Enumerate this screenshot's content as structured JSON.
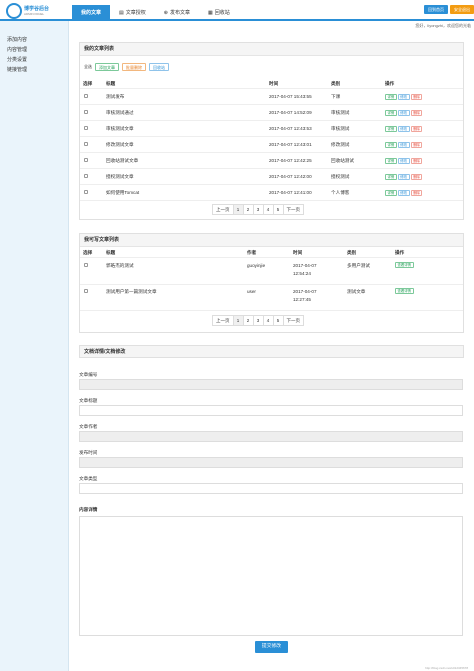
{
  "header": {
    "logo_text": "博学谷后台",
    "logo_sub": "ADMIN PANEL",
    "tabs": [
      {
        "label": "我的文章",
        "icon": "doc-icon",
        "active": true
      },
      {
        "label": "文章授权",
        "icon": "file-icon",
        "active": false
      },
      {
        "label": "发布文章",
        "icon": "plus-icon",
        "active": false
      },
      {
        "label": "回收站",
        "icon": "trash-icon",
        "active": false
      }
    ],
    "btn_home": "回到首页",
    "btn_logout": "安全退出",
    "greeting": "您好，liyongzhi，欢迎您的光临"
  },
  "sidebar": {
    "items": [
      "添加内容",
      "内容管理",
      "分类设置",
      "链接管理"
    ]
  },
  "my_articles": {
    "title": "我的文章列表",
    "select_all": "全选",
    "btn_add": "添加文章",
    "btn_delete": "批量删除",
    "btn_recycle": "回收站",
    "headers": [
      "选择",
      "标题",
      "时间",
      "类别",
      "操作"
    ],
    "rows": [
      {
        "title": "测试发布",
        "time": "2017-04-07 15:43:55",
        "category": "下课"
      },
      {
        "title": "审核测试通过",
        "time": "2017-04-07 14:52:09",
        "category": "审核测试"
      },
      {
        "title": "审核测试文章",
        "time": "2017-04-07 12:43:53",
        "category": "审核测试"
      },
      {
        "title": "修改测试文章",
        "time": "2017-04-07 12:43:01",
        "category": "修改测试"
      },
      {
        "title": "回收站测试文章",
        "time": "2017-04-07 12:42:25",
        "category": "回收站测试"
      },
      {
        "title": "授权测试文章",
        "time": "2017-04-07 12:42:00",
        "category": "授权测试"
      },
      {
        "title": "如何使用Tomcat",
        "time": "2017-04-07 12:41:00",
        "category": "个人博客"
      }
    ],
    "ops": {
      "detail": "详情",
      "edit": "修改",
      "delete": "删除"
    }
  },
  "editable_articles": {
    "title": "我可写文章列表",
    "headers": [
      "选择",
      "标题",
      "作者",
      "时间",
      "类别",
      "操作"
    ],
    "rows": [
      {
        "title": "郭皓杰的测试",
        "author": "guoyinjie",
        "date": "2017-04-07",
        "time": "12:54:24",
        "category": "多用户测试"
      },
      {
        "title": "测试用户第一篇测试文章",
        "author": "user",
        "date": "2017-04-07",
        "time": "12:27:45",
        "category": "测试文章"
      }
    ],
    "op_view": "查看详情"
  },
  "pager": {
    "prev": "上一页",
    "next": "下一页",
    "pages": [
      "1",
      "2",
      "3",
      "4",
      "5"
    ],
    "current": "1"
  },
  "editor": {
    "title": "文档详情/文档修改",
    "fields": {
      "id": "文章编号",
      "title": "文章标题",
      "author": "文章作者",
      "time": "发布时间",
      "type": "文章类型",
      "content": "内容详情"
    },
    "submit": "提交修改"
  },
  "watermark": "http://blog.csdn.net/u012345678",
  "colors": {
    "accent": "#2a8fd6",
    "home_btn": "#2a8fd6",
    "logout_btn": "#f39c12"
  }
}
